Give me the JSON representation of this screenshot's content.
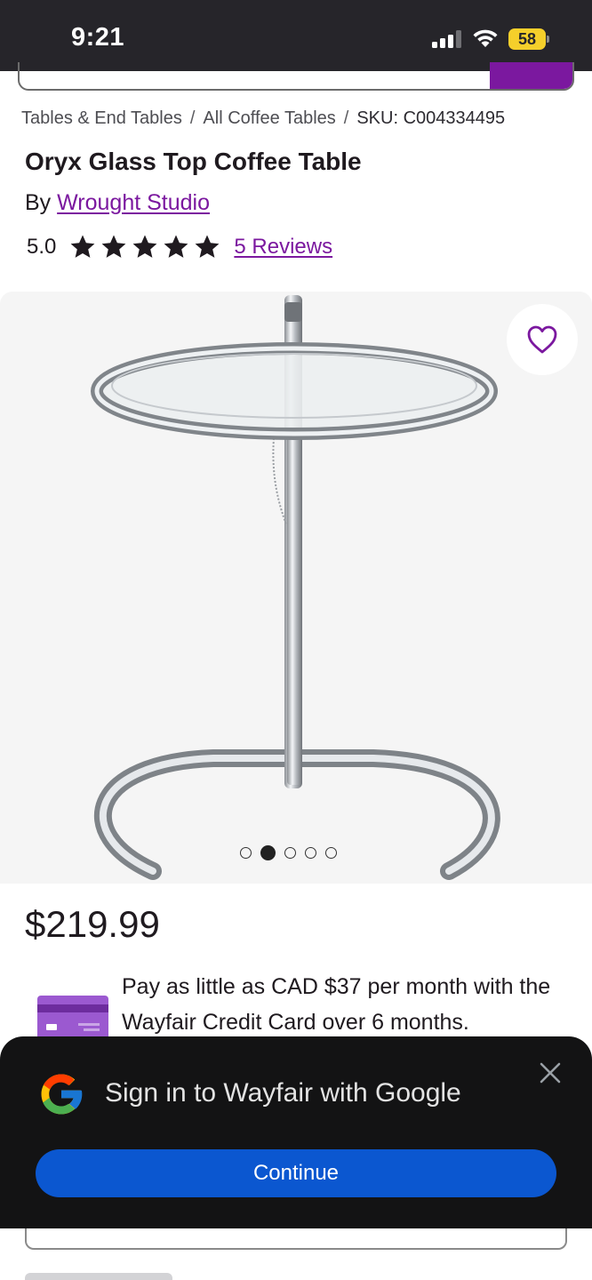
{
  "status_bar": {
    "time": "9:21",
    "battery_level": "58",
    "icons": [
      "cellular-signal-icon",
      "wifi-icon",
      "battery-icon"
    ]
  },
  "breadcrumb": {
    "items": [
      "Tables & End Tables",
      "All Coffee Tables"
    ],
    "separator": "/",
    "sku": "SKU: C004334495"
  },
  "product": {
    "title": "Oryx Glass Top Coffee Table",
    "by_prefix": "By",
    "brand": "Wrought Studio",
    "rating_value": "5.0",
    "rating_stars": 5,
    "reviews_link": "5 Reviews",
    "price": "$219.99"
  },
  "gallery": {
    "image_count": 5,
    "active_index": 1,
    "favorite_icon": "heart-outline-icon"
  },
  "financing": {
    "text": "Pay as little as CAD $37 per month with the Wayfair Credit Card over 6 months.",
    "icon": "credit-card-icon"
  },
  "google_prompt": {
    "title": "Sign in to Wayfair with Google",
    "continue_label": "Continue",
    "close_icon": "close-icon",
    "logo": "google-logo"
  },
  "colors": {
    "brand_purple": "#7b189f",
    "status_bar_bg": "#26252a",
    "google_button_blue": "#0b57d0",
    "sheet_bg": "#131314",
    "battery_yellow": "#f5cf2b"
  }
}
